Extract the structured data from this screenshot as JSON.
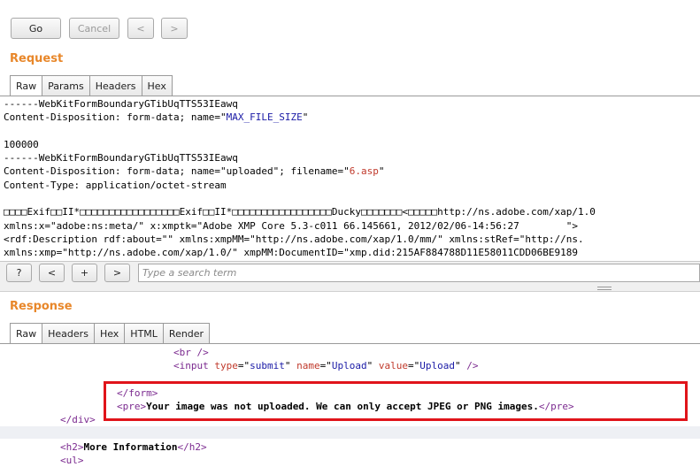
{
  "toolbar": {
    "go_label": "Go",
    "cancel_label": "Cancel",
    "back_label": "<",
    "forward_label": ">"
  },
  "request": {
    "title": "Request",
    "tabs": [
      "Raw",
      "Params",
      "Headers",
      "Hex"
    ],
    "active_tab": "Raw",
    "lines": [
      "------WebKitFormBoundaryGTibUqTTS53IEawq",
      "Content-Disposition: form-data; name=\"MAX_FILE_SIZE\"",
      "",
      "100000",
      "------WebKitFormBoundaryGTibUqTTS53IEawq",
      "Content-Disposition: form-data; name=\"uploaded\"; filename=\"6.asp\"",
      "Content-Type: application/octet-stream",
      "",
      "□□□□Exif□□II*□□□□□□□□□□□□□□□□□Exif□□II*□□□□□□□□□□□□□□□□□Ducky□□□□□□□<□□□□□http://ns.adobe.com/xap/1.0",
      "xmlns:x=\"adobe:ns:meta/\" x:xmptk=\"Adobe XMP Core 5.3-c011 66.145661, 2012/02/06-14:56:27        \">",
      "<rdf:Description rdf:about=\"\" xmlns:xmpMM=\"http://ns.adobe.com/xap/1.0/mm/\" xmlns:stRef=\"http://ns.",
      "xmlns:xmp=\"http://ns.adobe.com/xap/1.0/\" xmpMM:DocumentID=\"xmp.did:215AF884788D11E58011CDD06BE9189"
    ],
    "search": {
      "help_label": "?",
      "prev_label": "<",
      "add_label": "+",
      "next_label": ">",
      "placeholder": "Type a search term"
    }
  },
  "response": {
    "title": "Response",
    "tabs": [
      "Raw",
      "Headers",
      "Hex",
      "HTML",
      "Render"
    ],
    "active_tab": "Raw",
    "lines": [
      "<br />",
      "<input type=\"submit\" name=\"Upload\" value=\"Upload\" />",
      "",
      "</form>",
      "<pre>Your image was not uploaded. We can only accept JPEG or PNG images.</pre>",
      "</div>",
      "",
      "<h2>More Information</h2>",
      "<ul>"
    ]
  },
  "colors": {
    "section_title": "#e8872a",
    "highlight_border": "#e0141a",
    "tag_color": "#7b2a8f",
    "attr_color": "#c0392b",
    "value_color": "#1a1aa6"
  }
}
